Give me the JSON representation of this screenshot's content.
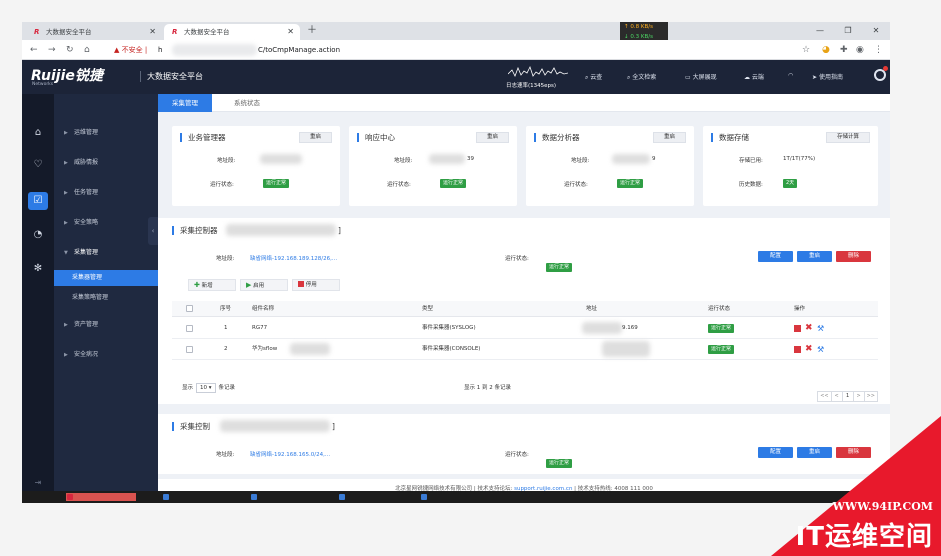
{
  "browser": {
    "tabs": [
      {
        "title": "大数据安全平台",
        "active": false
      },
      {
        "title": "大数据安全平台",
        "active": true
      }
    ],
    "net_up": "↑ 0.8 KB/s",
    "net_down": "↓ 0.3 KB/s",
    "insecure_label": "不安全",
    "url_prefix": "h",
    "url_suffix": "C/toCmpManage.action"
  },
  "header": {
    "logo": "Ruijie锐捷",
    "logo_sub": "Networks",
    "product": "大数据安全平台",
    "log_rate": "日志速率(1345eps)",
    "nav": [
      {
        "label": "云查",
        "icon": "search-icon"
      },
      {
        "label": "全文检索",
        "icon": "search-icon"
      },
      {
        "label": "大屏展现",
        "icon": "monitor-icon"
      },
      {
        "label": "云端",
        "icon": "cloud-icon"
      },
      {
        "label": "",
        "icon": "headset-icon"
      },
      {
        "label": "使用指南",
        "icon": "send-icon"
      }
    ]
  },
  "sidebar": {
    "items": [
      "运维管理",
      "威胁情报",
      "任务管理",
      "安全策略",
      "采集管理",
      "资产管理",
      "安全病况"
    ],
    "subitems": [
      "采集器管理",
      "采集策略管理"
    ]
  },
  "main": {
    "tabs": [
      "采集管理",
      "系统状态"
    ],
    "cards": [
      {
        "title": "业务管理器",
        "button": "重启",
        "row1_label": "地址段:",
        "row1_value": "",
        "row2_label": "运行状态:",
        "row2_value": "运行正常"
      },
      {
        "title": "响应中心",
        "button": "重启",
        "row1_label": "地址段:",
        "row1_value": "39",
        "row2_label": "运行状态:",
        "row2_value": "运行正常"
      },
      {
        "title": "数据分析器",
        "button": "重启",
        "row1_label": "地址段:",
        "row1_value": "9",
        "row2_label": "运行状态:",
        "row2_value": "运行正常"
      },
      {
        "title": "数据存储",
        "button": "存储计算",
        "row1_label": "存储已用:",
        "row1_value": "1T/1T(77%)",
        "row2_label": "历史数据:",
        "row2_value": "2天"
      }
    ],
    "collector1": {
      "title": "采集控制器",
      "bracket": "]",
      "segment_label": "地址段:",
      "segment_value": "缺省网络-192.168.189.128/26,...",
      "state_label": "运行状态:",
      "state_value": "运行正常",
      "buttons": [
        "配置",
        "重启",
        "删除"
      ],
      "toolbar": [
        "新增",
        "启用",
        "停用"
      ],
      "columns": [
        "序号",
        "组件名称",
        "类型",
        "地址",
        "运行状态",
        "操作"
      ],
      "rows": [
        {
          "index": "1",
          "name": "RG77",
          "type": "事件采集器(SYSLOG)",
          "address": "9.169",
          "status": "运行正常"
        },
        {
          "index": "2",
          "name": "华为sflow",
          "type": "事件采集器(CONSOLE)",
          "address": "",
          "status": "运行正常"
        }
      ],
      "pager_show": "显示",
      "page_size": "10",
      "pager_records": "条记录",
      "pager_info": "显示 1 到 2 条记录",
      "pager_buttons": [
        "<<",
        "<",
        "1",
        ">",
        ">>"
      ]
    },
    "collector2": {
      "title": "采集控制",
      "bracket": "]",
      "segment_label": "地址段:",
      "segment_value": "缺省网络-192.168.165.0/24,...",
      "state_label": "运行状态:",
      "state_value": "运行正常",
      "buttons": [
        "配置",
        "重启",
        "删除"
      ]
    },
    "footer": {
      "company": "北京星网锐捷网络技术有限公司",
      "forum": "技术支持论坛:",
      "forum_link": "support.ruijie.com.cn",
      "hotline": "技术支持热线: 4008 111 000"
    }
  },
  "watermark": {
    "site": "WWW.94IP.COM",
    "text": "IT运维空间"
  },
  "colors": {
    "accent": "#2d7be5",
    "header_bg": "#1c2438",
    "sidebar_bg": "#1f2940",
    "ok_green": "#2f9e44",
    "danger_red": "#d9363e"
  }
}
